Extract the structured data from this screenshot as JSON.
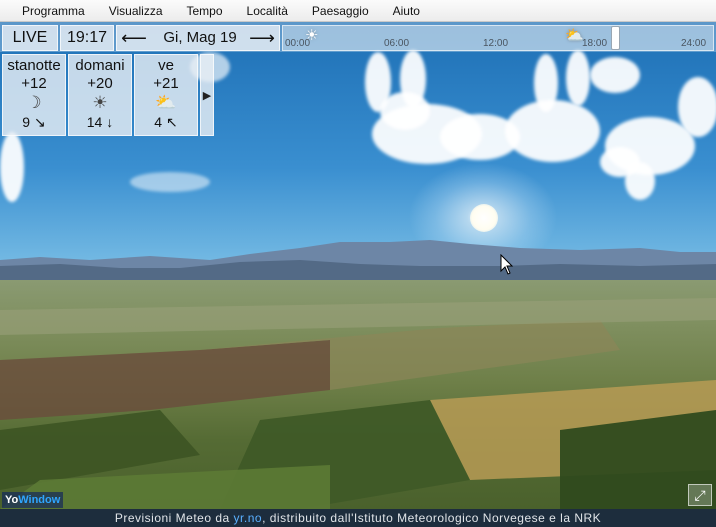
{
  "menu": {
    "items": [
      {
        "label": "Programma"
      },
      {
        "label": "Visualizza"
      },
      {
        "label": "Tempo"
      },
      {
        "label": "Località"
      },
      {
        "label": "Paesaggio"
      },
      {
        "label": "Aiuto"
      }
    ]
  },
  "toolbar": {
    "live_label": "LIVE",
    "time": "19:17",
    "prev_arrow": "⟵",
    "date": "Gi, Mag 19",
    "next_arrow": "⟶"
  },
  "timeline": {
    "ticks": [
      "00:00",
      "06:00",
      "12:00",
      "18:00",
      "24:00"
    ],
    "icons": [
      "sun-icon",
      "sun-cloud-icon"
    ],
    "current_position": 0.78
  },
  "forecast": [
    {
      "name": "stanotte",
      "temp": "+12",
      "icon": "moon-icon",
      "icon_glyph": "☽",
      "wind": "9 ↘"
    },
    {
      "name": "domani",
      "temp": "+20",
      "icon": "sun-icon",
      "icon_glyph": "☀",
      "wind": "14 ↓"
    },
    {
      "name": "ve",
      "temp": "+21",
      "icon": "sun-cloud-icon",
      "icon_glyph": "⛅",
      "wind": "4 ↖"
    }
  ],
  "forecast_more": "▶",
  "logo": {
    "prefix": "Yo",
    "suffix": "Window"
  },
  "footer": {
    "before": "Previsioni Meteo da ",
    "link": "yr.no",
    "after": ", distribuito dall'Istituto Meteorologico Norvegese e la NRK"
  },
  "colors": {
    "sky_top": "#1d6fb5",
    "footer_bg": "#1d2d3d",
    "link": "#5ab0ff"
  }
}
